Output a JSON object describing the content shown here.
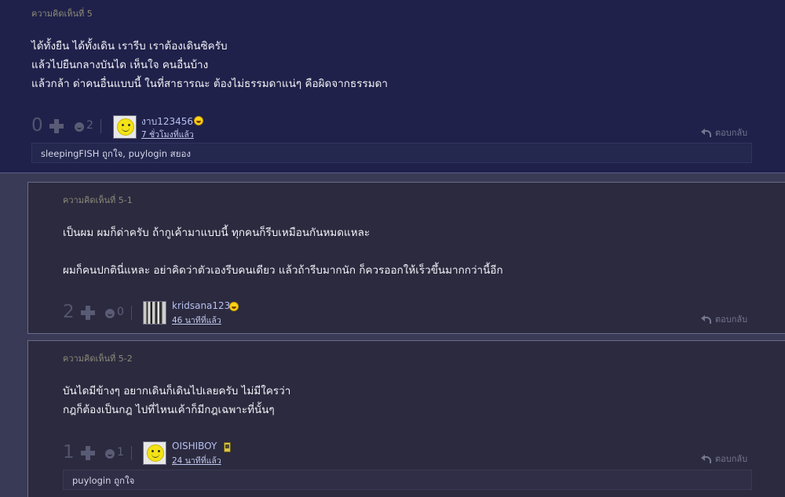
{
  "comments": [
    {
      "header": "ความคิดเห็นที่ 5",
      "body": [
        "ได้ทั้งยืน ได้ทั้งเดิน เรารีบ เราต้องเดินซิครับ",
        "แล้วไปยืนกลางบันได เห็นใจ คนอื่นบ้าง",
        "แล้วกล้า ด่าคนอื่นแบบนี้ ในที่สาธารณะ ต้องไม่ธรรมดาแน่ๆ คือผิดจากธรรมดา"
      ],
      "votes": "0",
      "emotions": "2",
      "user": "งาบ123456",
      "time": "7 ชั่วโมงที่แล้ว",
      "reply_label": "ตอบกลับ",
      "likes": "sleepingFISH ถูกใจ, puylogin สยอง"
    },
    {
      "header": "ความคิดเห็นที่ 5-1",
      "body": [
        "เป็นผม ผมก็ด่าครับ ถ้ากูเค้ามาแบบนี้ ทุกคนก็รีบเหมือนกันหมดแหละ",
        "",
        "ผมก็คนปกตินี่แหละ อย่าคิดว่าตัวเองรีบคนเดียว แล้วถ้ารีบมากนัก ก็ควรออกให้เร็วขึ้นมากกว่านี้อีก"
      ],
      "votes": "2",
      "emotions": "0",
      "user": "kridsana123",
      "time": "46 นาทีที่แล้ว",
      "reply_label": "ตอบกลับ"
    },
    {
      "header": "ความคิดเห็นที่ 5-2",
      "body": [
        "บันไดมีข้างๆ อยากเดินก็เดินไปเลยครับ ไม่มีใครว่า",
        "กฎก็ต้องเป็นกฎ ไปที่ไหนเค้าก็มีกฎเฉพาะที่นั้นๆ"
      ],
      "votes": "1",
      "emotions": "1",
      "user": "OISHIBOY",
      "time": "24 นาทีที่แล้ว",
      "reply_label": "ตอบกลับ",
      "likes": "puylogin ถูกใจ"
    }
  ],
  "icons": {
    "vote_plus": "plus-icon",
    "emotion": "emotion-icon",
    "reply": "reply-arrow-icon"
  },
  "colors": {
    "main_background": "#20214a",
    "reply_background": "#2b2a3f",
    "username": "#b7c0ee"
  }
}
